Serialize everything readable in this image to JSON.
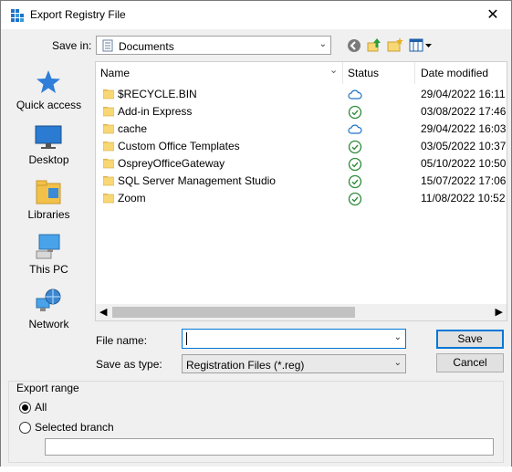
{
  "window": {
    "title": "Export Registry File",
    "close_glyph": "✕"
  },
  "location": {
    "label": "Save in:",
    "value": "Documents"
  },
  "places": [
    {
      "label": "Quick access",
      "icon": "quick-access-star-icon"
    },
    {
      "label": "Desktop",
      "icon": "desktop-icon"
    },
    {
      "label": "Libraries",
      "icon": "libraries-icon"
    },
    {
      "label": "This PC",
      "icon": "this-pc-icon"
    },
    {
      "label": "Network",
      "icon": "network-icon"
    }
  ],
  "columns": {
    "name": "Name",
    "status": "Status",
    "date": "Date modified"
  },
  "files": [
    {
      "name": "$RECYCLE.BIN",
      "status": "cloud",
      "date": "29/04/2022 16:11"
    },
    {
      "name": "Add-in Express",
      "status": "synced",
      "date": "03/08/2022 17:46"
    },
    {
      "name": "cache",
      "status": "cloud",
      "date": "29/04/2022 16:03"
    },
    {
      "name": "Custom Office Templates",
      "status": "synced",
      "date": "03/05/2022 10:37"
    },
    {
      "name": "OspreyOfficeGateway",
      "status": "synced",
      "date": "05/10/2022 10:50"
    },
    {
      "name": "SQL Server Management Studio",
      "status": "synced",
      "date": "15/07/2022 17:06"
    },
    {
      "name": "Zoom",
      "status": "synced",
      "date": "11/08/2022 10:52"
    }
  ],
  "form": {
    "file_name_label": "File name:",
    "file_name_value": "",
    "type_label": "Save as type:",
    "type_value": "Registration Files (*.reg)",
    "save_label": "Save",
    "cancel_label": "Cancel"
  },
  "export_range": {
    "legend": "Export range",
    "all_label": "All",
    "branch_label": "Selected branch",
    "selected": "all",
    "branch_value": ""
  },
  "colors": {
    "accent": "#0078d7",
    "folder": "#f8d775",
    "synced": "#2e8b3a",
    "cloud": "#1e73c9"
  }
}
